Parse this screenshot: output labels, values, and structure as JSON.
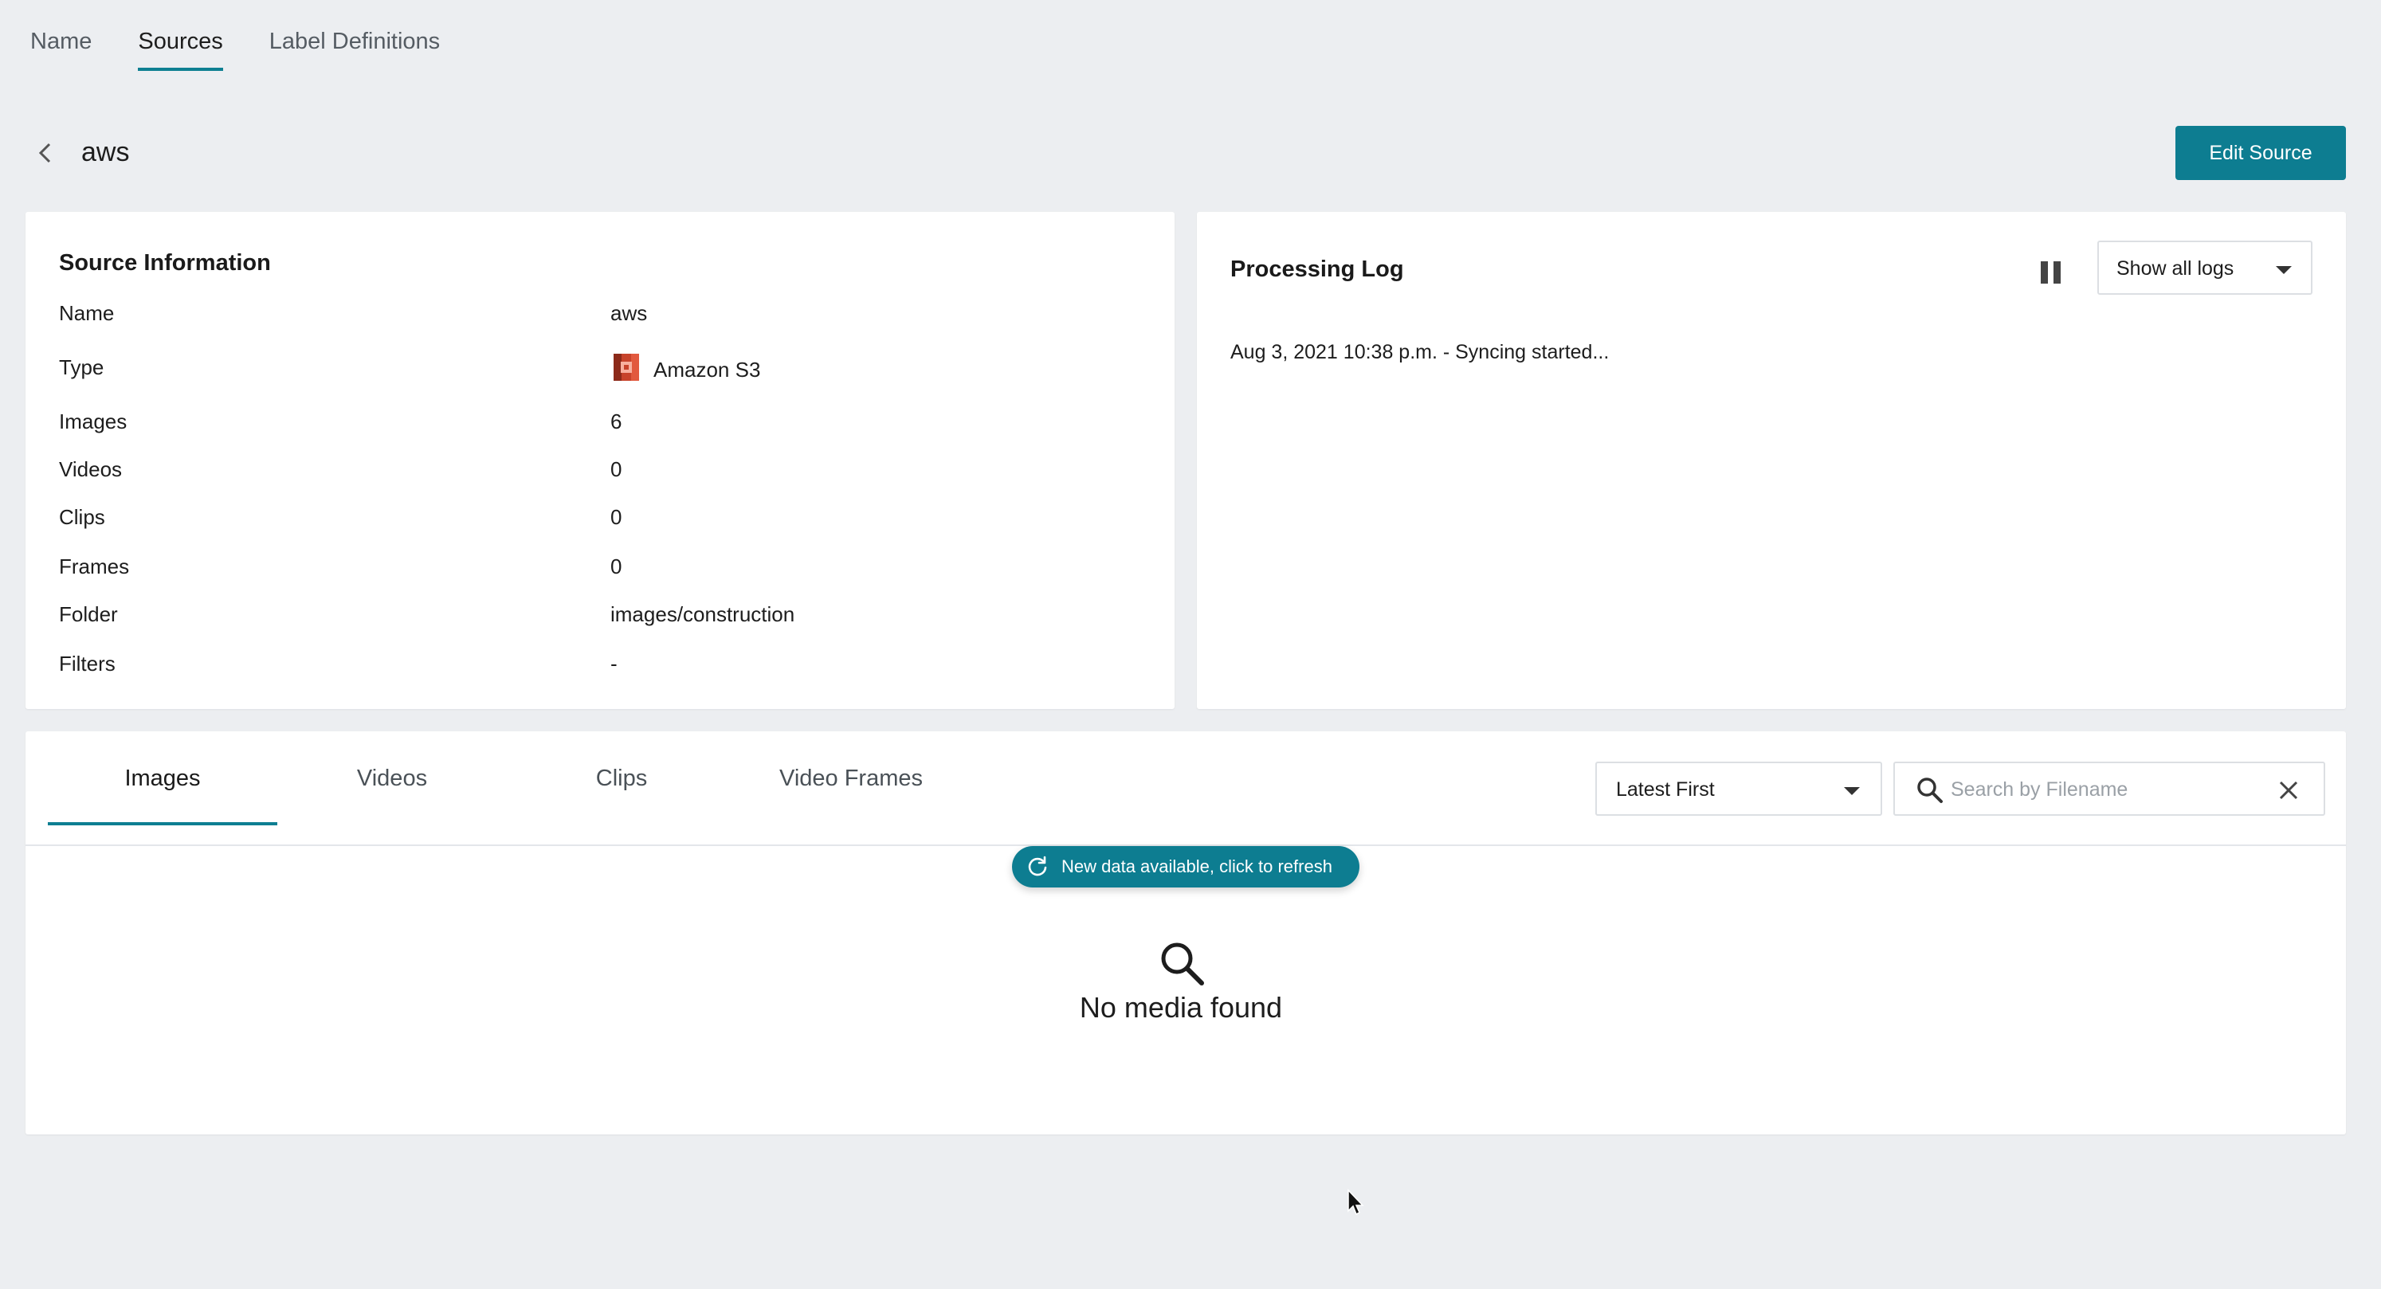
{
  "top_tabs": [
    {
      "label": "Name",
      "active": false
    },
    {
      "label": "Sources",
      "active": true
    },
    {
      "label": "Label Definitions",
      "active": false
    }
  ],
  "header": {
    "title": "aws",
    "edit_button": "Edit Source"
  },
  "source_info": {
    "title": "Source Information",
    "rows": [
      {
        "label": "Name",
        "value": "aws"
      },
      {
        "label": "Type",
        "value": "Amazon S3",
        "icon": "amazon-s3-icon"
      },
      {
        "label": "Images",
        "value": "6"
      },
      {
        "label": "Videos",
        "value": "0"
      },
      {
        "label": "Clips",
        "value": "0"
      },
      {
        "label": "Frames",
        "value": "0"
      },
      {
        "label": "Folder",
        "value": "images/construction"
      },
      {
        "label": "Filters",
        "value": "-"
      }
    ]
  },
  "processing_log": {
    "title": "Processing Log",
    "filter_selected": "Show all logs",
    "entries": [
      "Aug 3, 2021 10:38 p.m. - Syncing started..."
    ]
  },
  "media": {
    "tabs": [
      {
        "label": "Images",
        "active": true
      },
      {
        "label": "Videos",
        "active": false
      },
      {
        "label": "Clips",
        "active": false
      },
      {
        "label": "Video Frames",
        "active": false
      }
    ],
    "sort_selected": "Latest First",
    "search_placeholder": "Search by Filename",
    "search_value": "",
    "refresh_notice": "New data available, click to refresh",
    "empty_message": "No media found"
  },
  "colors": {
    "accent": "#0d7d91",
    "background": "#eceef1",
    "card": "#ffffff",
    "s3_icon": "#c7432b"
  }
}
